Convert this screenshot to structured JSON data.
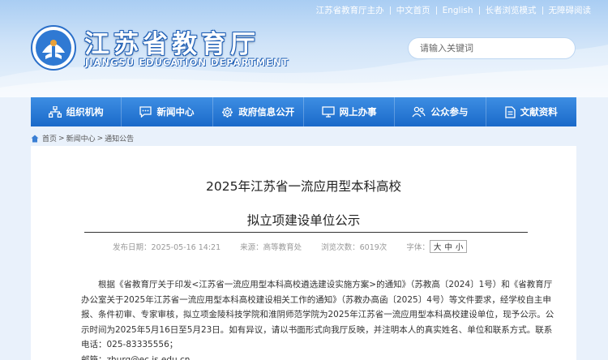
{
  "topbar": {
    "host": "江苏省教育厅主办",
    "links": [
      "中文首页",
      "English",
      "长者浏览模式",
      "无障碍阅读"
    ]
  },
  "site": {
    "title": "江苏省教育厅",
    "subtitle": "JIANGSU EDUCATION DEPARTMENT"
  },
  "search": {
    "placeholder": "请输入关键词"
  },
  "nav": {
    "items": [
      {
        "label": "组织机构",
        "icon": "org-chart-icon"
      },
      {
        "label": "新闻中心",
        "icon": "chat-bubble-icon"
      },
      {
        "label": "政府信息公开",
        "icon": "gear-icon"
      },
      {
        "label": "网上办事",
        "icon": "monitor-icon"
      },
      {
        "label": "公众参与",
        "icon": "people-icon"
      },
      {
        "label": "文献资料",
        "icon": "document-icon"
      }
    ]
  },
  "breadcrumb": {
    "items": [
      "首页",
      "新闻中心",
      "通知公告"
    ],
    "separator": ">"
  },
  "article": {
    "title_line1": "2025年江苏省一流应用型本科高校",
    "title_line2": "拟立项建设单位公示",
    "published": "发布日期：2025-05-16 14:21",
    "source": "来源：高等教育处",
    "views": "浏览次数：6019次",
    "font_label": "字体：",
    "font_sizes": [
      "大",
      "中",
      "小"
    ],
    "body": "根据《省教育厅关于印发<江苏省一流应用型本科高校遴选建设实施方案>的通知》（苏教高〔2024〕1号）和《省教育厅办公室关于2025年江苏省一流应用型本科高校建设相关工作的通知》（苏教办高函〔2025〕4号）等文件要求，经学校自主申报、条件初审、专家审核，拟立项金陵科技学院和淮阴师范学院为2025年江苏省一流应用型本科高校建设单位，现予公示。公示时间为2025年5月16日至5月23日。如有异议，请以书面形式向我厅反映，并注明本人的真实姓名、单位和联系方式。联系电话：025-83335556；",
    "email": "邮箱：zhurq@ec.js.edu.cn。"
  },
  "colors": {
    "nav": "#1f6fd0",
    "header_top": "#a9cdf3",
    "page_bg": "#e9f1fb"
  }
}
